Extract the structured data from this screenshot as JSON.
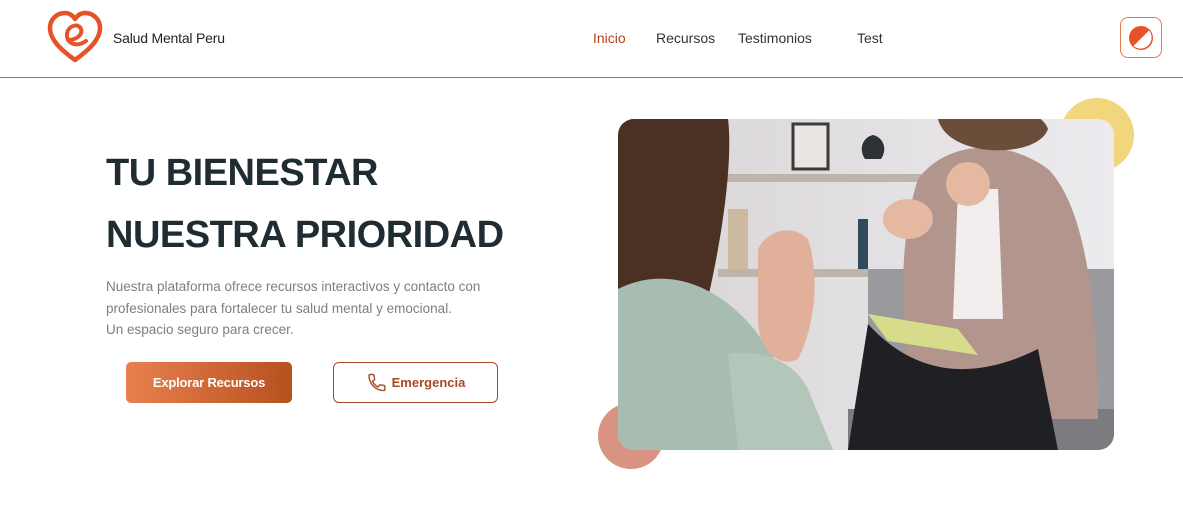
{
  "brand": {
    "name": "Salud Mental Peru",
    "logo_icon": "heart-e-logo-icon"
  },
  "nav": {
    "items": [
      {
        "label": "Inicio",
        "active": true
      },
      {
        "label": "Recursos",
        "active": false
      },
      {
        "label": "Testimonios",
        "active": false
      },
      {
        "label": "Test",
        "active": false
      }
    ],
    "theme_toggle_icon": "contrast-icon"
  },
  "hero": {
    "title_line1": "TU BIENESTAR",
    "title_line2": "NUESTRA PRIORIDAD",
    "description": [
      "Nuestra plataforma ofrece recursos interactivos y contacto con",
      "profesionales para fortalecer tu salud mental y emocional.",
      "Un espacio seguro para crecer."
    ],
    "primary_button": "Explorar Recursos",
    "emergency_button": "Emergencia",
    "emergency_icon": "phone-icon",
    "image_subject": "therapy-session-photo"
  },
  "colors": {
    "accent": "#b5401a",
    "button_gradient_start": "#e9804f",
    "button_gradient_end": "#b6511f",
    "title": "#1f2d33",
    "text_muted": "#7a7f84",
    "decor_yellow": "#f2d67d",
    "decor_rose": "#d99383"
  }
}
